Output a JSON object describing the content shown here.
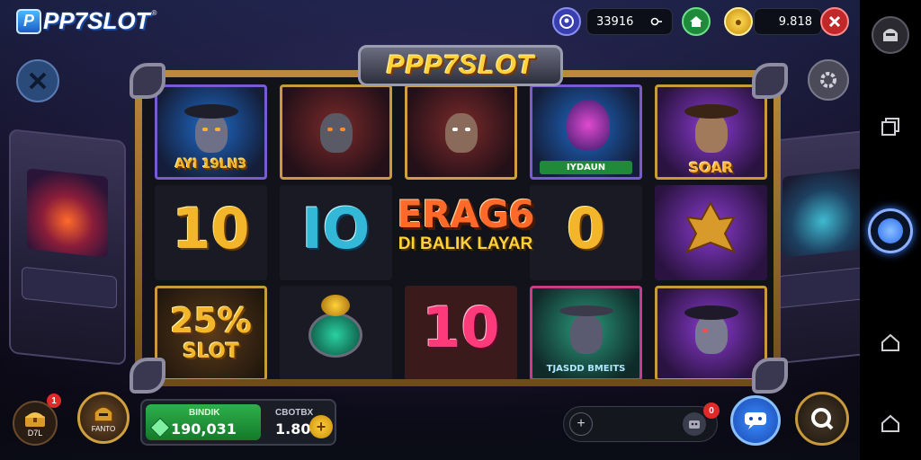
{
  "app": {
    "logo_badge": "P",
    "logo_text": "PP7SLOT",
    "logo_reg": "®"
  },
  "topbar": {
    "user_value": "33916",
    "coins_value": "9.818",
    "user_icon": "user-circle-icon",
    "home_icon": "home-icon",
    "close_icon": "close-icon"
  },
  "banner": {
    "title": "PPP7SLOT"
  },
  "reels": {
    "r1": {
      "top_label": "AYI 19LN3",
      "mid_value": "10",
      "bot_value": "25%",
      "bot_sub": "SLOT"
    },
    "r2": {
      "mid_value": "IO"
    },
    "r3": {
      "bot_value": "10"
    },
    "r4": {
      "top_label": "IYDAUN",
      "mid_value": "0",
      "bot_label": "TJASDD BMEITS"
    },
    "r5": {
      "top_label": "SOAR"
    }
  },
  "center": {
    "big": "ERAG6",
    "sub": "DI BALIK LAYAR"
  },
  "bottom": {
    "gift_label": "D7L",
    "gift_badge": "1",
    "avatar_label": "FANTO",
    "balance_label": "BINDIK",
    "balance_value": "190,031",
    "bet_label": "CBOTBX",
    "bet_value": "1.80",
    "bet_plus": "+",
    "search_badge": "0",
    "search_add": "+"
  },
  "colors": {
    "gold": "#f3b62a",
    "teal": "#33b8d8",
    "pink": "#ff3a7a",
    "green": "#2fb04a"
  }
}
